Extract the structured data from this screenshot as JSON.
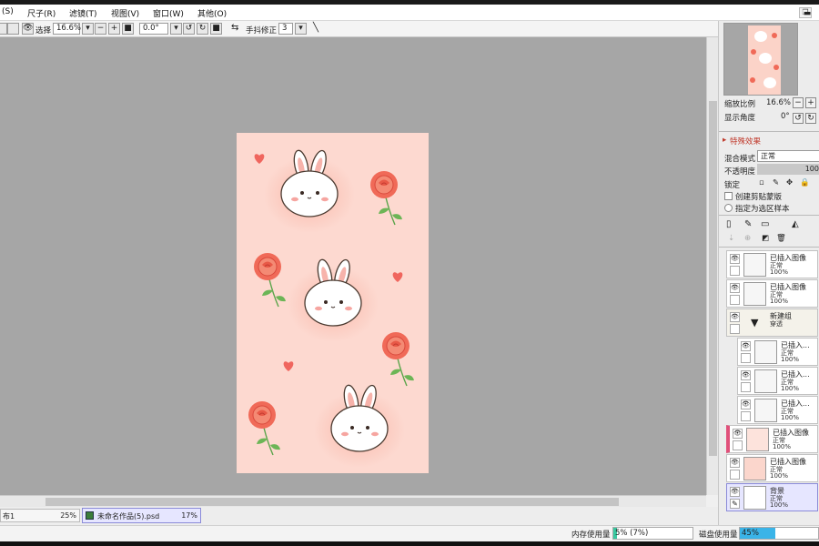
{
  "menu": [
    "(S)",
    "尺子(R)",
    "滤镜(T)",
    "视图(V)",
    "窗口(W)",
    "其他(O)"
  ],
  "toolbar": {
    "select_label": "选择",
    "zoom": "16.6%",
    "angle": "0.0°",
    "stabilizer_label": "手抖修正",
    "stabilizer_value": "3"
  },
  "navigator": {
    "zoom_label": "缩放比例",
    "zoom_value": "16.6%",
    "angle_label": "显示角度",
    "angle_value": "0°"
  },
  "effects": {
    "header": "特殊效果",
    "blend_label": "混合模式",
    "blend_value": "正常",
    "opacity_label": "不透明度",
    "opacity_value": "100",
    "lock_label": "锁定",
    "clip_label": "创建剪贴蒙版",
    "sample_label": "指定为选区样本"
  },
  "layers": [
    {
      "name": "已插入图像",
      "mode": "正常",
      "opacity": "100%"
    },
    {
      "name": "已插入图像",
      "mode": "正常",
      "opacity": "100%"
    },
    {
      "name": "新建组",
      "mode": "穿透",
      "opacity": ""
    },
    {
      "name": "已插入...",
      "mode": "正常",
      "opacity": "100%"
    },
    {
      "name": "已插入...",
      "mode": "正常",
      "opacity": "100%"
    },
    {
      "name": "已插入...",
      "mode": "正常",
      "opacity": "100%"
    },
    {
      "name": "已插入图像",
      "mode": "正常",
      "opacity": "100%"
    },
    {
      "name": "已插入图像",
      "mode": "正常",
      "opacity": "100%"
    },
    {
      "name": "背景",
      "mode": "正常",
      "opacity": "100%"
    }
  ],
  "tabs": [
    {
      "name": "布1",
      "zoom": "25%"
    },
    {
      "name": "未命名作品(5).psd",
      "zoom": "17%"
    }
  ],
  "status": {
    "memory_label": "内存使用量",
    "memory_value": "5% (7%)",
    "memory_fraction": 0.05,
    "disk_label": "磁盘使用量",
    "disk_value": "45%",
    "disk_fraction": 0.45
  },
  "colors": {
    "canvas_bg": "#a6a6a6",
    "artwork_bg": "#fdd9d0",
    "selected_layer": "#e6e6ff",
    "clip_marker": "#e0507a"
  }
}
